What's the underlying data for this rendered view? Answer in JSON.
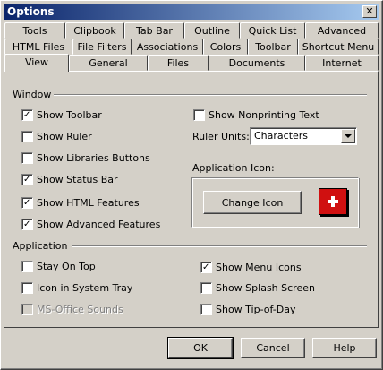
{
  "window": {
    "title": "Options",
    "close_glyph": "✕"
  },
  "tabs": {
    "row1": [
      "Tools",
      "Clipbook",
      "Tab Bar",
      "Outline",
      "Quick List",
      "Advanced"
    ],
    "row2": [
      "HTML Files",
      "File Filters",
      "Associations",
      "Colors",
      "Toolbar",
      "Shortcut Menu"
    ],
    "row3": [
      "View",
      "General",
      "Files",
      "Documents",
      "Internet"
    ],
    "active": "View"
  },
  "window_group": {
    "label": "Window",
    "checkboxes": [
      {
        "label": "Show Toolbar",
        "checked": true
      },
      {
        "label": "Show Ruler",
        "checked": false
      },
      {
        "label": "Show Libraries Buttons",
        "checked": false
      },
      {
        "label": "Show Status Bar",
        "checked": true
      },
      {
        "label": "Show HTML Features",
        "checked": true
      },
      {
        "label": "Show Advanced Features",
        "checked": true
      }
    ],
    "show_nonprinting": {
      "label": "Show Nonprinting Text",
      "checked": false
    },
    "ruler_units": {
      "label": "Ruler Units:",
      "value": "Characters"
    },
    "app_icon": {
      "label": "Application Icon:",
      "change_button": "Change Icon",
      "icon": "red-cross-icon"
    }
  },
  "application_group": {
    "label": "Application",
    "left": [
      {
        "label": "Stay On Top",
        "checked": false,
        "disabled": false
      },
      {
        "label": "Icon in System Tray",
        "checked": false,
        "disabled": false
      },
      {
        "label": "MS-Office Sounds",
        "checked": false,
        "disabled": true
      }
    ],
    "right": [
      {
        "label": "Show Menu Icons",
        "checked": true
      },
      {
        "label": "Show Splash Screen",
        "checked": false
      },
      {
        "label": "Show Tip-of-Day",
        "checked": false
      }
    ]
  },
  "buttons": {
    "ok": "OK",
    "cancel": "Cancel",
    "help": "Help"
  },
  "colors": {
    "titlebar_start": "#0a246a",
    "titlebar_end": "#a6caf0",
    "face": "#d4d0c8",
    "icon_red": "#d01010"
  }
}
